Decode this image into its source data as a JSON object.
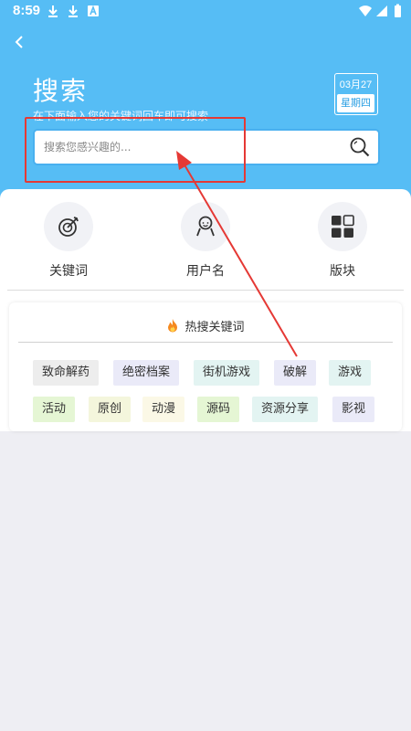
{
  "status": {
    "time": "8:59"
  },
  "header": {
    "title": "搜索",
    "subtitle": "在下面输入您的关键词回车即可搜索",
    "date": {
      "month_day": "03月27",
      "weekday": "星期四"
    }
  },
  "search": {
    "placeholder": "搜索您感兴趣的...",
    "value": ""
  },
  "categories": [
    {
      "label": "关键词",
      "icon": "target-icon"
    },
    {
      "label": "用户名",
      "icon": "user-icon"
    },
    {
      "label": "版块",
      "icon": "grid-icon"
    }
  ],
  "hot": {
    "title": "热搜关键词",
    "tags": [
      {
        "label": "致命解药",
        "color": "#ededed"
      },
      {
        "label": "绝密档案",
        "color": "#eaeaf8"
      },
      {
        "label": "街机游戏",
        "color": "#e3f4f2"
      },
      {
        "label": "破解",
        "color": "#eaeaf8"
      },
      {
        "label": "游戏",
        "color": "#e3f4f2"
      },
      {
        "label": "活动",
        "color": "#e5f6d4"
      },
      {
        "label": "原创",
        "color": "#f4f6dc"
      },
      {
        "label": "动漫",
        "color": "#fbf8e6"
      },
      {
        "label": "源码",
        "color": "#e5f6d4"
      },
      {
        "label": "资源分享",
        "color": "#e3f4f2"
      },
      {
        "label": "影视",
        "color": "#eaeaf8"
      }
    ]
  },
  "colors": {
    "header": "#56bdf5",
    "annotation": "#e53935"
  }
}
